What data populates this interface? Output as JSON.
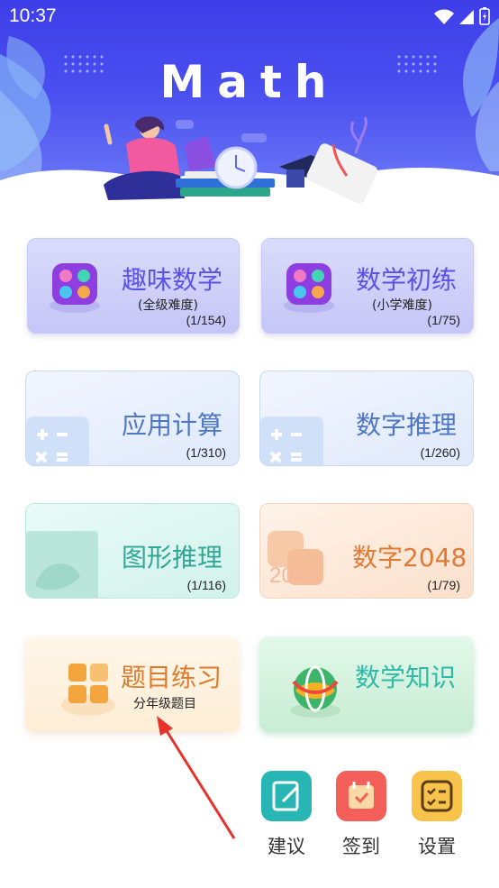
{
  "status": {
    "time": "10:37"
  },
  "hero": {
    "title": "Math"
  },
  "cards": [
    {
      "title": "趣味数学",
      "subtitle": "(全级难度)",
      "count": "(1/154)"
    },
    {
      "title": "数学初练",
      "subtitle": "(小学难度)",
      "count": "(1/75)"
    },
    {
      "title": "应用计算",
      "count": "(1/310)"
    },
    {
      "title": "数字推理",
      "count": "(1/260)"
    },
    {
      "title": "图形推理",
      "count": "(1/116)"
    },
    {
      "title": "数字2048",
      "count": "(1/79)",
      "watermark": "2048"
    },
    {
      "title": "题目练习",
      "subtitle": "分年级题目"
    },
    {
      "title": "数学知识"
    }
  ],
  "bottom": {
    "suggest": "建议",
    "checkin": "签到",
    "settings": "设置"
  },
  "colors": {
    "header": "#4349ee",
    "suggest_icon": "#27b6b4",
    "checkin_icon": "#f45f5a",
    "settings_icon": "#f8c34a",
    "arrow": "#e8312b"
  }
}
